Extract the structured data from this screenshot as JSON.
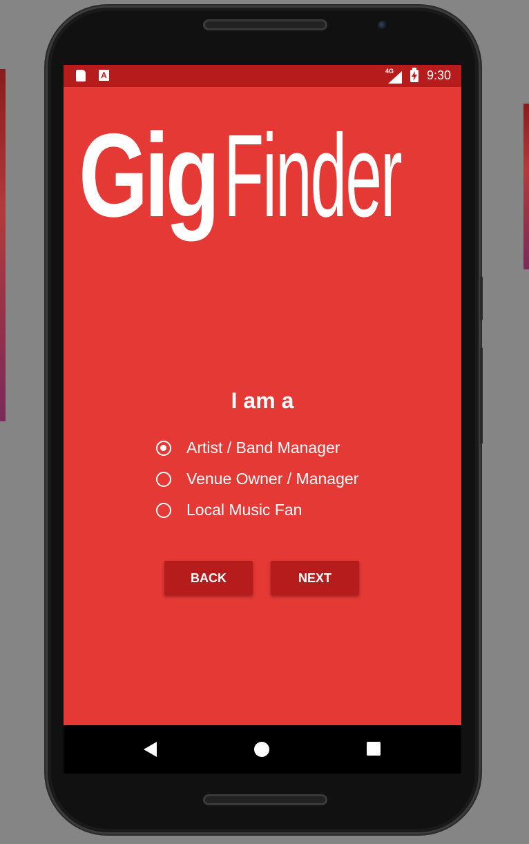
{
  "status_bar": {
    "network": "4G",
    "time": "9:30",
    "notification_icons": [
      "sd-card-icon",
      "a-letter-icon"
    ],
    "status_icons": [
      "signal-icon",
      "battery-charging-icon"
    ]
  },
  "logo": {
    "part_bold": "Gig",
    "part_light": "Finder"
  },
  "form": {
    "heading": "I am a",
    "options": [
      {
        "label": "Artist / Band Manager",
        "checked": true
      },
      {
        "label": "Venue Owner / Manager",
        "checked": false
      },
      {
        "label": "Local Music Fan",
        "checked": false
      }
    ],
    "back_label": "BACK",
    "next_label": "NEXT"
  },
  "nav_bar": {
    "icons": [
      "nav-back-icon",
      "nav-home-icon",
      "nav-recents-icon"
    ]
  },
  "colors": {
    "primary": "#e53935",
    "primary_dark": "#b71c1c",
    "text": "#ffffff"
  }
}
